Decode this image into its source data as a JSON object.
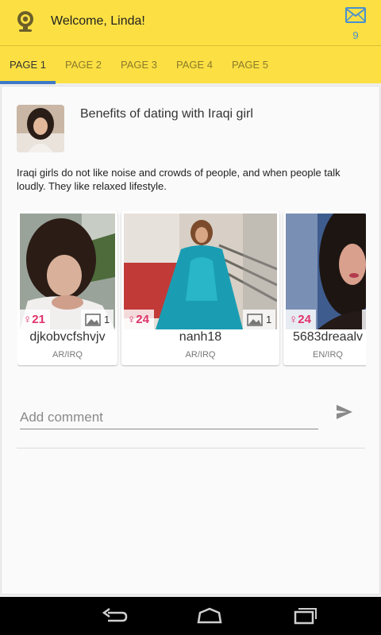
{
  "header": {
    "title": "Welcome, Linda!",
    "unread_count": "9",
    "accent_color": "#fce043",
    "icons": {
      "logo": "webcam-logo-icon",
      "mail": "mail-icon"
    }
  },
  "tabs": [
    {
      "label": "PAGE 1",
      "active": true
    },
    {
      "label": "PAGE 2",
      "active": false
    },
    {
      "label": "PAGE 3",
      "active": false
    },
    {
      "label": "PAGE 4",
      "active": false
    },
    {
      "label": "PAGE 5",
      "active": false
    }
  ],
  "post": {
    "title": "Benefits of dating with Iraqi girl",
    "body": "Iraqi girls do not like noise and crowds of people, and when people talk loudly. They like relaxed lifestyle."
  },
  "profiles": [
    {
      "name": "djkobvcfshvjv",
      "age": "21",
      "photos": "1",
      "country": "AR/IRQ"
    },
    {
      "name": "nanh18",
      "age": "24",
      "photos": "1",
      "country": "AR/IRQ"
    },
    {
      "name": "5683dreaalv",
      "age": "24",
      "photos": "",
      "country": "EN/IRQ"
    }
  ],
  "comment": {
    "placeholder": "Add comment"
  },
  "colors": {
    "age_badge": "#e0336b",
    "tab_indicator": "#3d79c7",
    "unread": "#4a8fd0"
  }
}
